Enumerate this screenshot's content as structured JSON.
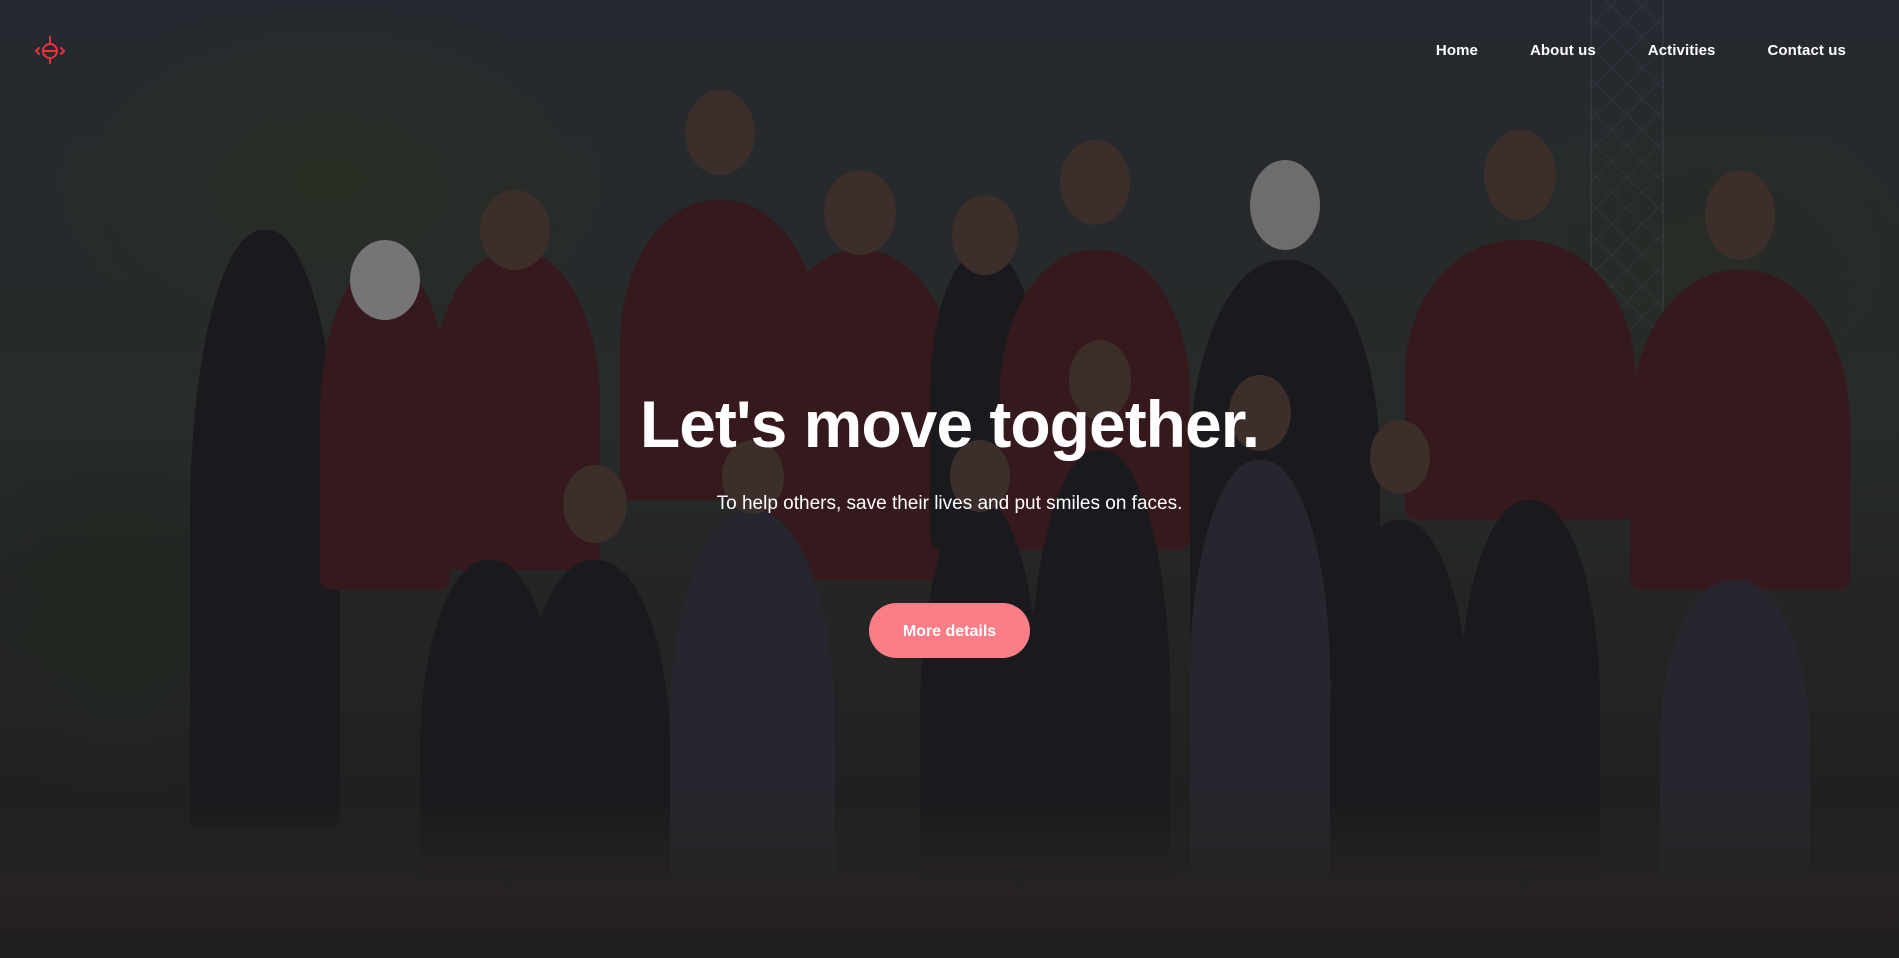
{
  "nav": {
    "logo_icon": "ribbon-logo-icon",
    "links": [
      {
        "label": "Home"
      },
      {
        "label": "About us"
      },
      {
        "label": "Activities"
      },
      {
        "label": "Contact us"
      }
    ]
  },
  "hero": {
    "headline": "Let's move together.",
    "subheadline": "To help others, save their lives and put smiles on faces.",
    "cta_label": "More details",
    "background_image": "group-photo-volunteers-in-red-shirts"
  },
  "colors": {
    "accent": "#fb7e86",
    "logo": "#e8323c",
    "text": "#ffffff",
    "overlay": "#16181e"
  }
}
